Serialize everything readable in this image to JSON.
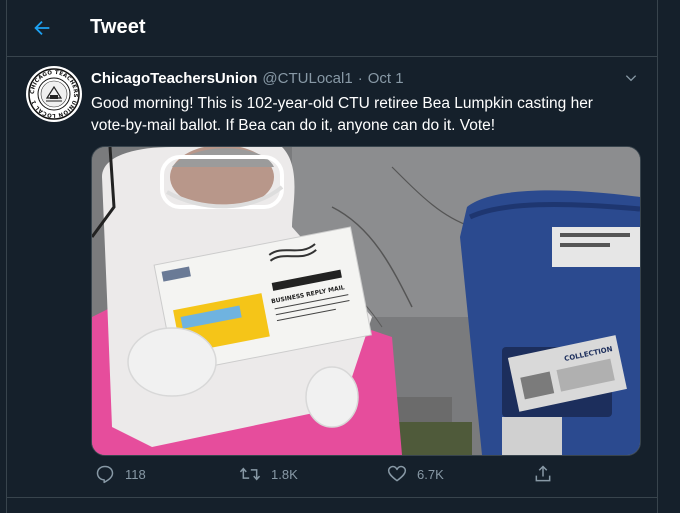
{
  "header": {
    "title": "Tweet",
    "back_icon": "arrow-left-icon"
  },
  "tweet": {
    "display_name": "ChicagoTeachersUnion",
    "handle": "@CTULocal1",
    "separator": "·",
    "date": "Oct 1",
    "text": "Good morning! This is 102-year-old CTU retiree Bea Lumpkin casting her vote-by-mail ballot. If Bea can do it, anyone can do it. Vote!",
    "avatar_icon": "ctu-seal-logo",
    "avatar_logo_text": "CHICAGO TEACHERS UNION LOCAL 1",
    "media": {
      "envelope_label": "BUSINESS REPLY MAIL",
      "mailbox_label": "COLLECTION"
    }
  },
  "actions": {
    "reply": {
      "icon": "reply-icon",
      "count": "118"
    },
    "retweet": {
      "icon": "retweet-icon",
      "count": "1.8K"
    },
    "like": {
      "icon": "heart-icon",
      "count": "6.7K"
    },
    "share": {
      "icon": "share-icon"
    }
  },
  "colors": {
    "background": "#15202b",
    "border": "#38444d",
    "accent": "#1da1f2",
    "secondary_text": "#8899a6"
  }
}
